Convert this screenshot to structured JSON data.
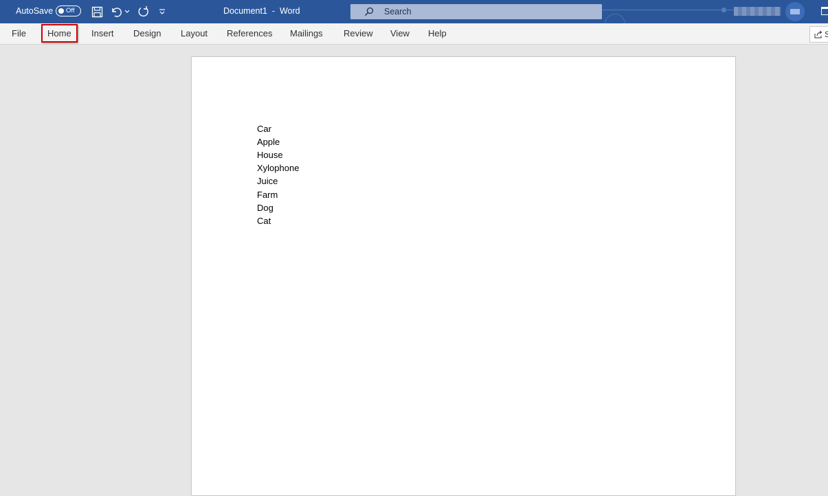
{
  "titlebar": {
    "autosave_label": "AutoSave",
    "autosave_state": "Off",
    "document_title": "Document1  -  Word",
    "search_placeholder": "Search",
    "accent_color": "#2b579a",
    "icons": [
      "save-icon",
      "undo-icon",
      "undo-dropdown-icon",
      "redo-icon",
      "customize-qat-icon",
      "search-icon"
    ]
  },
  "ribbon": {
    "tabs": [
      "File",
      "Home",
      "Insert",
      "Design",
      "Layout",
      "References",
      "Mailings",
      "Review",
      "View",
      "Help"
    ],
    "share_label": "S",
    "highlight_color": "#d00000"
  },
  "document": {
    "lines": [
      "Car",
      "Apple",
      "House",
      "Xylophone",
      "Juice",
      "Farm",
      "Dog",
      "Cat"
    ]
  }
}
